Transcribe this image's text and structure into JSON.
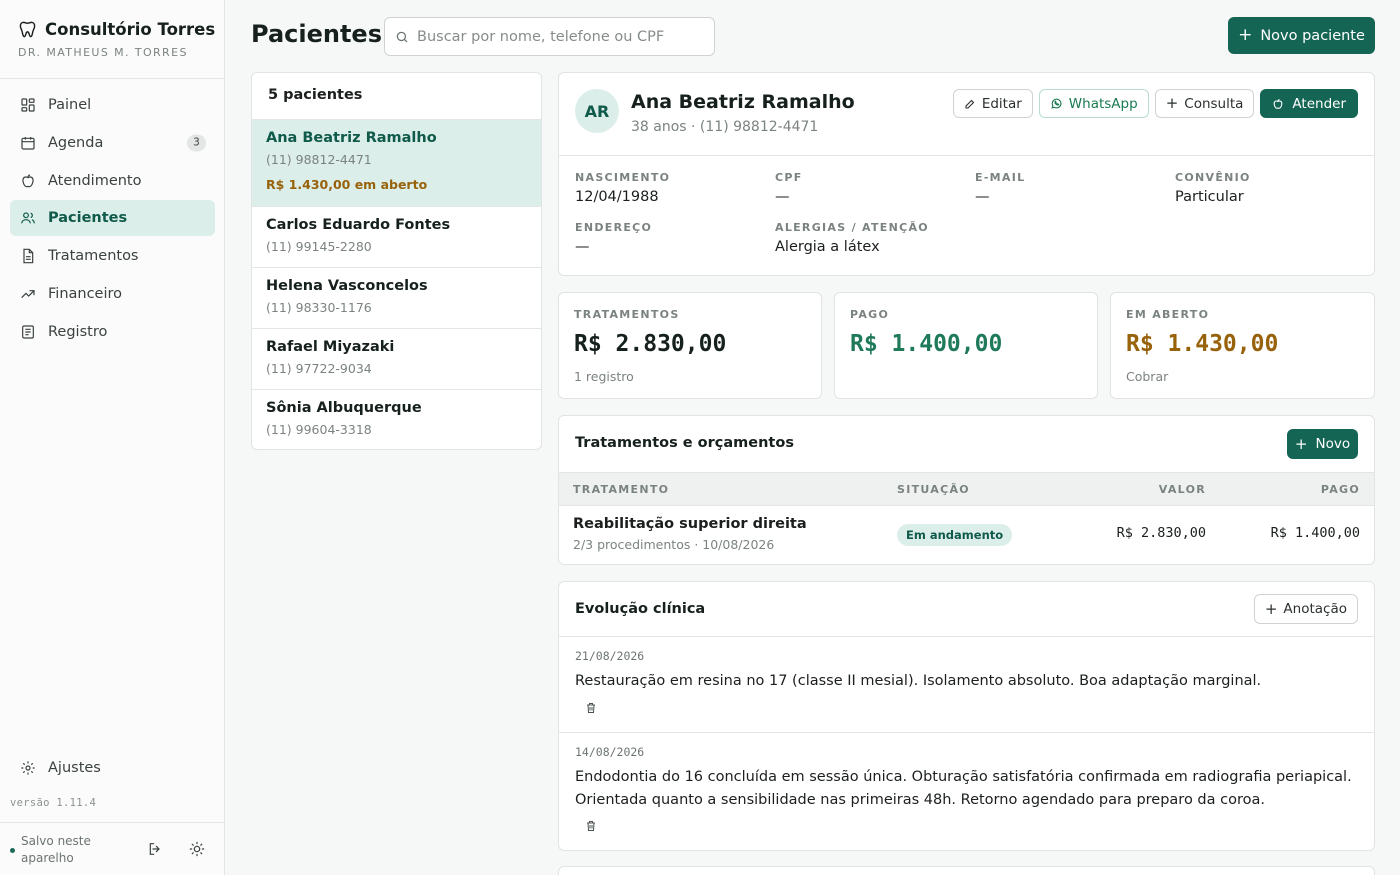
{
  "brand": {
    "title": "Consultório Torres",
    "subtitle": "DR. MATHEUS M. TORRES",
    "icon": "tooth-icon"
  },
  "nav": [
    {
      "label": "Painel",
      "icon": "grid-icon",
      "active": false
    },
    {
      "label": "Agenda",
      "icon": "calendar-icon",
      "badge": "3",
      "active": false
    },
    {
      "label": "Atendimento",
      "icon": "apple-icon",
      "active": false
    },
    {
      "label": "Pacientes",
      "icon": "users-icon",
      "active": true
    },
    {
      "label": "Tratamentos",
      "icon": "document-icon",
      "active": false
    },
    {
      "label": "Financeiro",
      "icon": "trending-up-icon",
      "active": false
    },
    {
      "label": "Registro",
      "icon": "list-icon",
      "active": false
    }
  ],
  "settings_label": "Ajustes",
  "version": "versão 1.11.4",
  "footer": {
    "saved": "Salvo neste aparelho"
  },
  "page": {
    "title": "Pacientes",
    "search_placeholder": "Buscar por nome, telefone ou CPF",
    "new_patient": "Novo paciente"
  },
  "patient_list": {
    "count": "5 pacientes",
    "items": [
      {
        "name": "Ana Beatriz Ramalho",
        "phone": "(11) 98812-4471",
        "due": "R$ 1.430,00 em aberto"
      },
      {
        "name": "Carlos Eduardo Fontes",
        "phone": "(11) 99145-2280"
      },
      {
        "name": "Helena Vasconcelos",
        "phone": "(11) 98330-1176"
      },
      {
        "name": "Rafael Miyazaki",
        "phone": "(11) 97722-9034"
      },
      {
        "name": "Sônia Albuquerque",
        "phone": "(11) 99604-3318"
      }
    ]
  },
  "profile": {
    "initials": "AR",
    "name": "Ana Beatriz Ramalho",
    "subtitle": "38 anos · (11) 98812-4471",
    "actions": {
      "edit": "Editar",
      "whatsapp": "WhatsApp",
      "consult": "Consulta",
      "attend": "Atender"
    },
    "fields": {
      "birth_label": "NASCIMENTO",
      "birth": "12/04/1988",
      "cpf_label": "CPF",
      "cpf": "—",
      "email_label": "E-MAIL",
      "email": "—",
      "plan_label": "CONVÊNIO",
      "plan": "Particular",
      "address_label": "ENDEREÇO",
      "address": "—",
      "allergy_label": "ALERGIAS / ATENÇÃO",
      "allergy": "Alergia a látex"
    }
  },
  "stats": {
    "treatments": {
      "label": "TRATAMENTOS",
      "value": "R$ 2.830,00",
      "sub": "1 registro"
    },
    "paid": {
      "label": "PAGO",
      "value": "R$ 1.400,00"
    },
    "open": {
      "label": "EM ABERTO",
      "value": "R$ 1.430,00",
      "sub": "Cobrar"
    }
  },
  "colors": {
    "accent": "#156554",
    "paid": "#1f7a5a",
    "open": "#98620b"
  },
  "treatments": {
    "title": "Tratamentos e orçamentos",
    "new": "Novo",
    "columns": {
      "treatment": "TRATAMENTO",
      "status": "SITUAÇÃO",
      "value": "VALOR",
      "paid": "PAGO"
    },
    "rows": [
      {
        "name": "Reabilitação superior direita",
        "meta": "2/3 procedimentos · 10/08/2026",
        "status": "Em andamento",
        "value": "R$ 2.830,00",
        "paid": "R$ 1.400,00"
      }
    ]
  },
  "evolution": {
    "title": "Evolução clínica",
    "add": "Anotação",
    "entries": [
      {
        "date": "21/08/2026",
        "text": "Restauração em resina no 17 (classe II mesial). Isolamento absoluto. Boa adaptação marginal."
      },
      {
        "date": "14/08/2026",
        "text": "Endodontia do 16 concluída em sessão única. Obturação satisfatória confirmada em radiografia periapical. Orientada quanto a sensibilidade nas primeiras 48h. Retorno agendado para preparo da coroa."
      }
    ]
  }
}
